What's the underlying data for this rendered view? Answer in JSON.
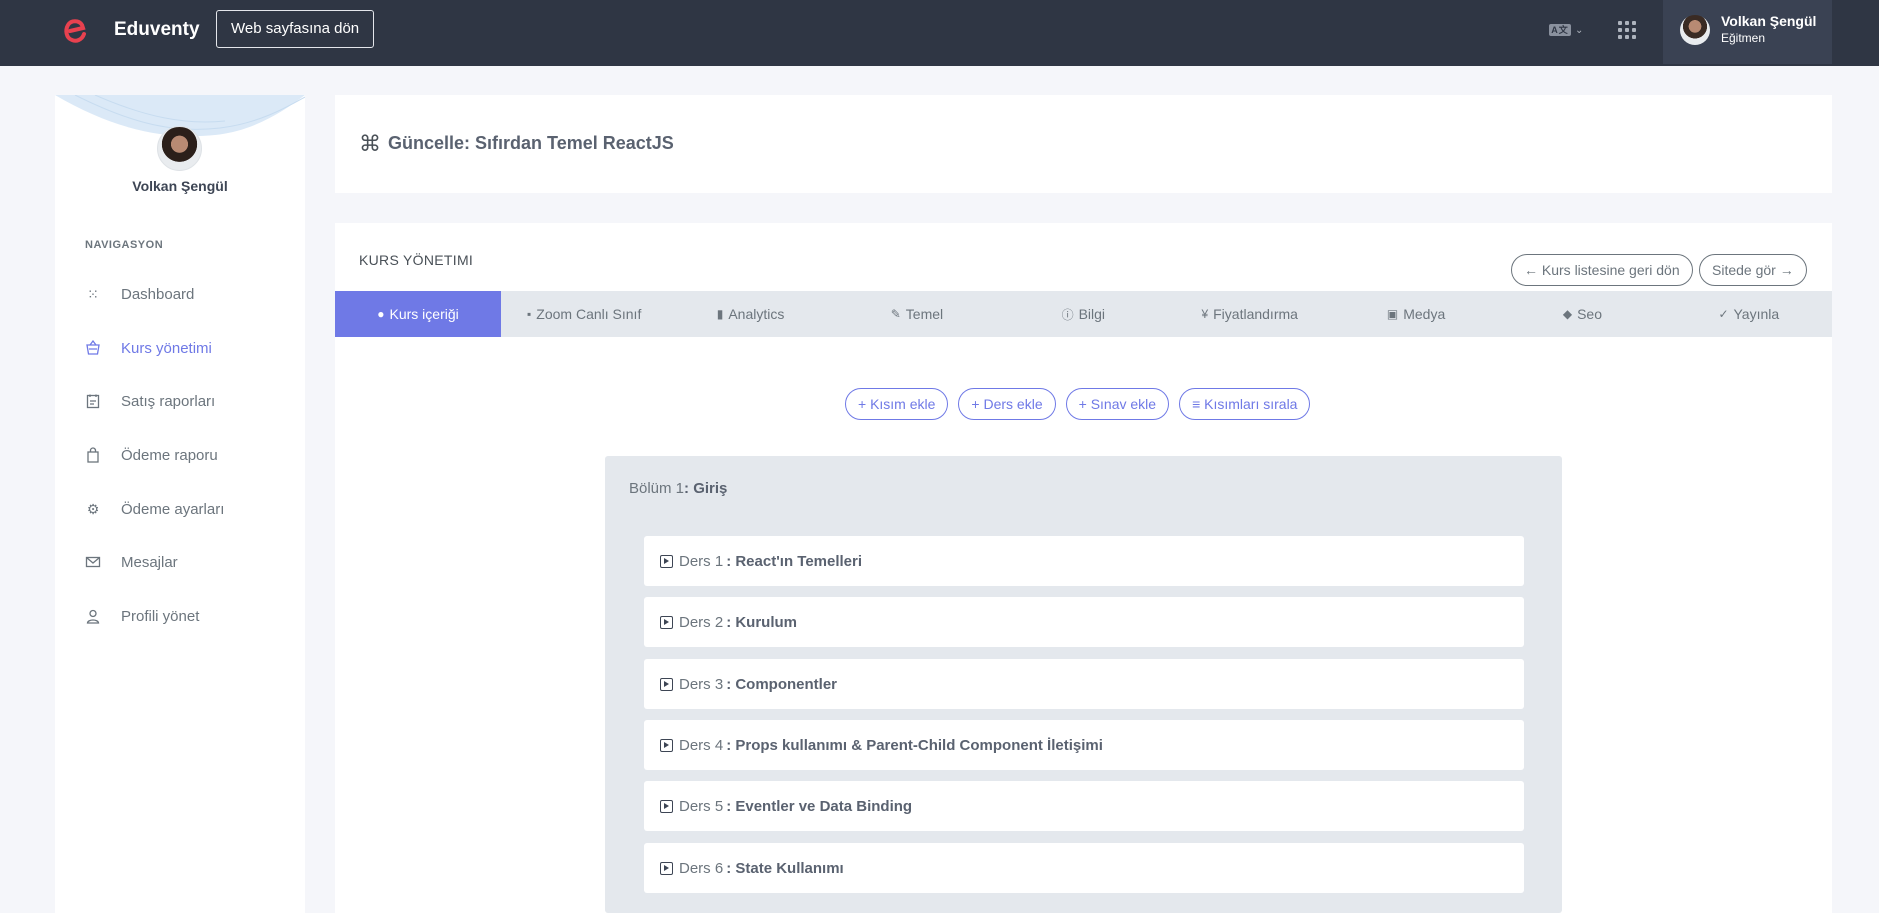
{
  "app": {
    "brand": "Eduventy",
    "back_to_web": "Web sayfasına dön",
    "lang_badge": "A文",
    "user": {
      "name": "Volkan Şengül",
      "role": "Eğitmen"
    }
  },
  "sidebar": {
    "name": "Volkan Şengül",
    "nav_title": "NAVIGASYON",
    "items": [
      {
        "label": "Dashboard",
        "icon": "grid-dots-icon"
      },
      {
        "label": "Kurs yönetimi",
        "icon": "basket-icon",
        "active": true
      },
      {
        "label": "Satış raporları",
        "icon": "clipboard-icon"
      },
      {
        "label": "Ödeme raporu",
        "icon": "bag-icon"
      },
      {
        "label": "Ödeme ayarları",
        "icon": "gear-icon"
      },
      {
        "label": "Mesajlar",
        "icon": "mail-icon"
      },
      {
        "label": "Profili yönet",
        "icon": "user-icon"
      }
    ]
  },
  "page": {
    "title": "Güncelle: Sıfırdan Temel ReactJS"
  },
  "course": {
    "section_title": "KURS YÖNETIMI",
    "back_to_list": "← Kurs listesine geri dön",
    "view_on_site": "Sitede gör →",
    "tabs": [
      {
        "label": "Kurs içeriği",
        "icon": "●"
      },
      {
        "label": "Zoom Canlı Sınıf",
        "icon": "▪"
      },
      {
        "label": "Analytics",
        "icon": "▮"
      },
      {
        "label": "Temel",
        "icon": "✎"
      },
      {
        "label": "Bilgi",
        "icon": "ⓘ"
      },
      {
        "label": "Fiyatlandırma",
        "icon": "¥"
      },
      {
        "label": "Medya",
        "icon": "▣"
      },
      {
        "label": "Seo",
        "icon": "◆"
      },
      {
        "label": "Yayınla",
        "icon": "✓"
      }
    ],
    "actions": [
      "+ Kısım ekle",
      "+ Ders ekle",
      "+ Sınav ekle",
      "≡ Kısımları sırala"
    ],
    "section": {
      "prefix": "Bölüm 1",
      "name": ": Giriş",
      "lessons": [
        {
          "prefix": "Ders 1",
          "name": ": React'ın Temelleri"
        },
        {
          "prefix": "Ders 2",
          "name": ": Kurulum"
        },
        {
          "prefix": "Ders 3",
          "name": ": Componentler"
        },
        {
          "prefix": "Ders 4",
          "name": ": Props kullanımı & Parent-Child Component İletişimi"
        },
        {
          "prefix": "Ders 5",
          "name": ": Eventler ve Data Binding"
        },
        {
          "prefix": "Ders 6",
          "name": ": State Kullanımı"
        }
      ]
    }
  },
  "colors": {
    "accent": "#6f79e6",
    "topbar": "#2f3644",
    "brand_logo": "#e8414f"
  }
}
